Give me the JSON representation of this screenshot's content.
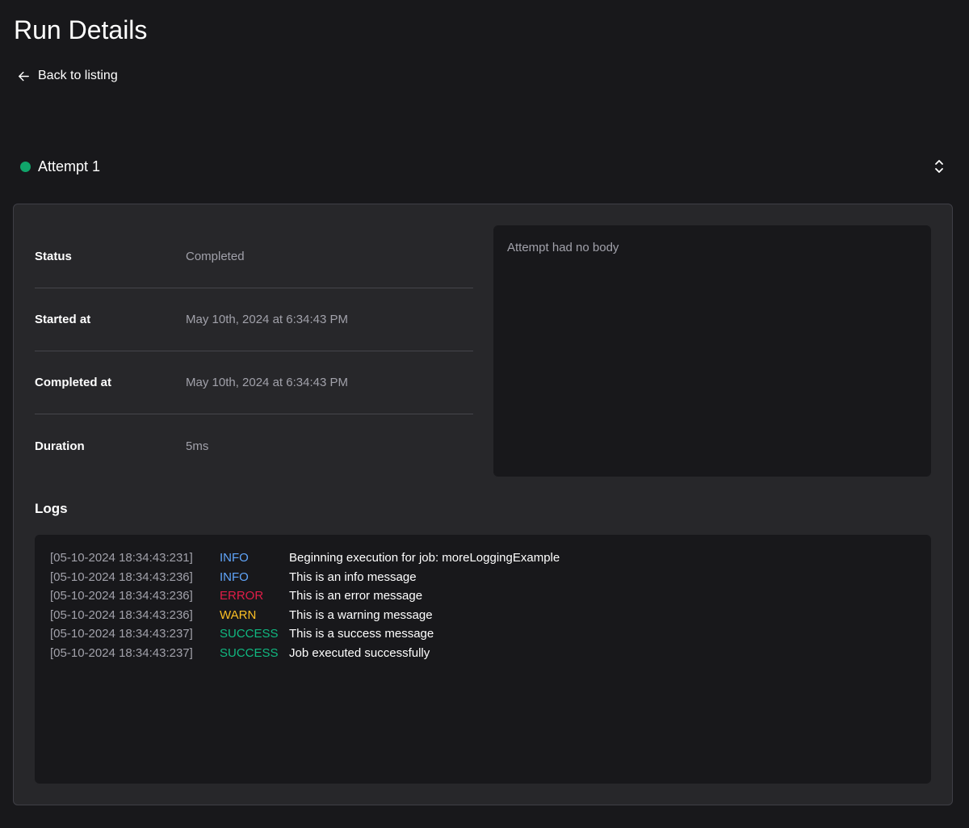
{
  "page": {
    "title": "Run Details",
    "back_label": "Back to listing"
  },
  "attempt": {
    "label": "Attempt 1",
    "status_color": "#10a46a"
  },
  "details": [
    {
      "label": "Status",
      "value": "Completed"
    },
    {
      "label": "Started at",
      "value": "May 10th, 2024 at 6:34:43 PM"
    },
    {
      "label": "Completed at",
      "value": "May 10th, 2024 at 6:34:43 PM"
    },
    {
      "label": "Duration",
      "value": "5ms"
    }
  ],
  "body": {
    "text": "Attempt had no body"
  },
  "logs": {
    "title": "Logs",
    "entries": [
      {
        "time": "[05-10-2024 18:34:43:231]",
        "level": "INFO",
        "message": "Beginning execution for job: moreLoggingExample"
      },
      {
        "time": "[05-10-2024 18:34:43:236]",
        "level": "INFO",
        "message": "This is an info message"
      },
      {
        "time": "[05-10-2024 18:34:43:236]",
        "level": "ERROR",
        "message": "This is an error message"
      },
      {
        "time": "[05-10-2024 18:34:43:236]",
        "level": "WARN",
        "message": "This is a warning message"
      },
      {
        "time": "[05-10-2024 18:34:43:237]",
        "level": "SUCCESS",
        "message": "This is a success message"
      },
      {
        "time": "[05-10-2024 18:34:43:237]",
        "level": "SUCCESS",
        "message": "Job executed successfully"
      }
    ]
  },
  "level_colors": {
    "INFO": "#60a5fa",
    "ERROR": "#e11d48",
    "WARN": "#fbbf24",
    "SUCCESS": "#10b981"
  },
  "icons": {
    "back": "arrow-left-icon",
    "expand": "chevrons-up-down-icon"
  }
}
